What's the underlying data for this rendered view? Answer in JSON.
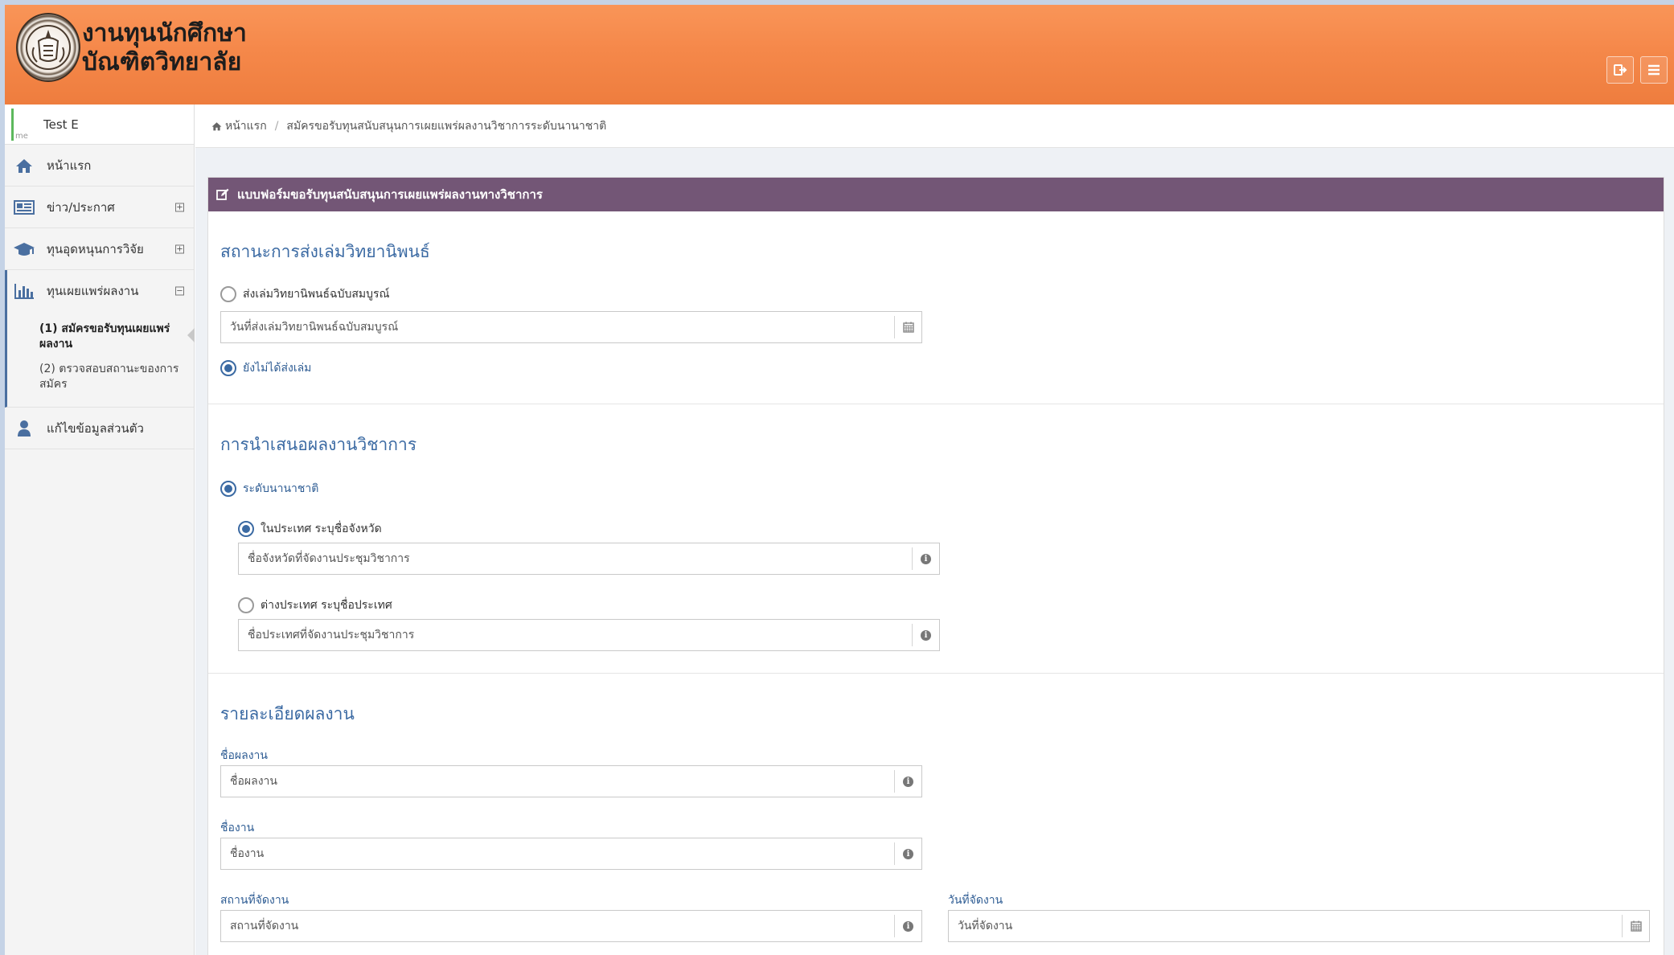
{
  "header": {
    "title_line1": "งานทุนนักศึกษา",
    "title_line2": "บัณฑิตวิทยาลัย",
    "logout_icon": "sign-out-icon",
    "menu_icon": "hamburger-icon"
  },
  "sidebar": {
    "user": {
      "avatar_alt": "me",
      "name": "Test E"
    },
    "items": [
      {
        "label": "หน้าแรก",
        "icon": "home-icon"
      },
      {
        "label": "ข่าว/ประกาศ",
        "icon": "newspaper-icon",
        "toggle": "+"
      },
      {
        "label": "ทุนอุดหนุนการวิจัย",
        "icon": "graduation-cap-icon",
        "toggle": "+"
      },
      {
        "label": "ทุนเผยแพร่ผลงาน",
        "icon": "bar-chart-icon",
        "toggle": "−"
      },
      {
        "label": "แก้ไขข้อมูลส่วนตัว",
        "icon": "user-icon"
      }
    ],
    "submenu": [
      {
        "label": "(1) สมัครขอรับทุนเผยแพร่ผลงาน",
        "active": true
      },
      {
        "label": "(2) ตรวจสอบสถานะของการสมัคร",
        "active": false
      }
    ]
  },
  "breadcrumb": {
    "home": "หน้าแรก",
    "current": "สมัครขอรับทุนสนับสนุนการเผยแพร่ผลงานวิชาการระดับนานาชาติ"
  },
  "panel": {
    "title": "แบบฟอร์มขอรับทุนสนับสนุนการเผยแพร่ผลงานทางวิชาการ"
  },
  "thesis_status": {
    "title": "สถานะการส่งเล่มวิทยานิพนธ์",
    "option_submitted": "ส่งเล่มวิทยานิพนธ์ฉบับสมบูรณ์",
    "submit_date_placeholder": "วันที่ส่งเล่มวิทยานิพนธ์ฉบับสมบูรณ์",
    "option_not_submitted": "ยังไม่ได้ส่งเล่ม",
    "selected": "not_submitted"
  },
  "presentation": {
    "title": "การนำเสนอผลงานวิชาการ",
    "level_international": "ระดับนานาชาติ",
    "option_domestic": "ในประเทศ ระบุชื่อจังหวัด",
    "province_placeholder": "ชื่อจังหวัดที่จัดงานประชุมวิชาการ",
    "option_abroad": "ต่างประเทศ ระบุชื่อประเทศ",
    "country_placeholder": "ชื่อประเทศที่จัดงานประชุมวิชาการ",
    "selected": "domestic"
  },
  "details": {
    "title": "รายละเอียดผลงาน",
    "work_name_label": "ชื่อผลงาน",
    "work_name_placeholder": "ชื่อผลงาน",
    "event_name_label": "ชื่องาน",
    "event_name_placeholder": "ชื่องาน",
    "venue_label": "สถานที่จัดงาน",
    "venue_placeholder": "สถานที่จัดงาน",
    "event_date_label": "วันที่จัดงาน",
    "event_date_placeholder": "วันที่จัดงาน"
  },
  "colors": {
    "header_orange": "#f5884a",
    "panel_purple": "#735676",
    "accent_blue": "#3b6aa3"
  }
}
